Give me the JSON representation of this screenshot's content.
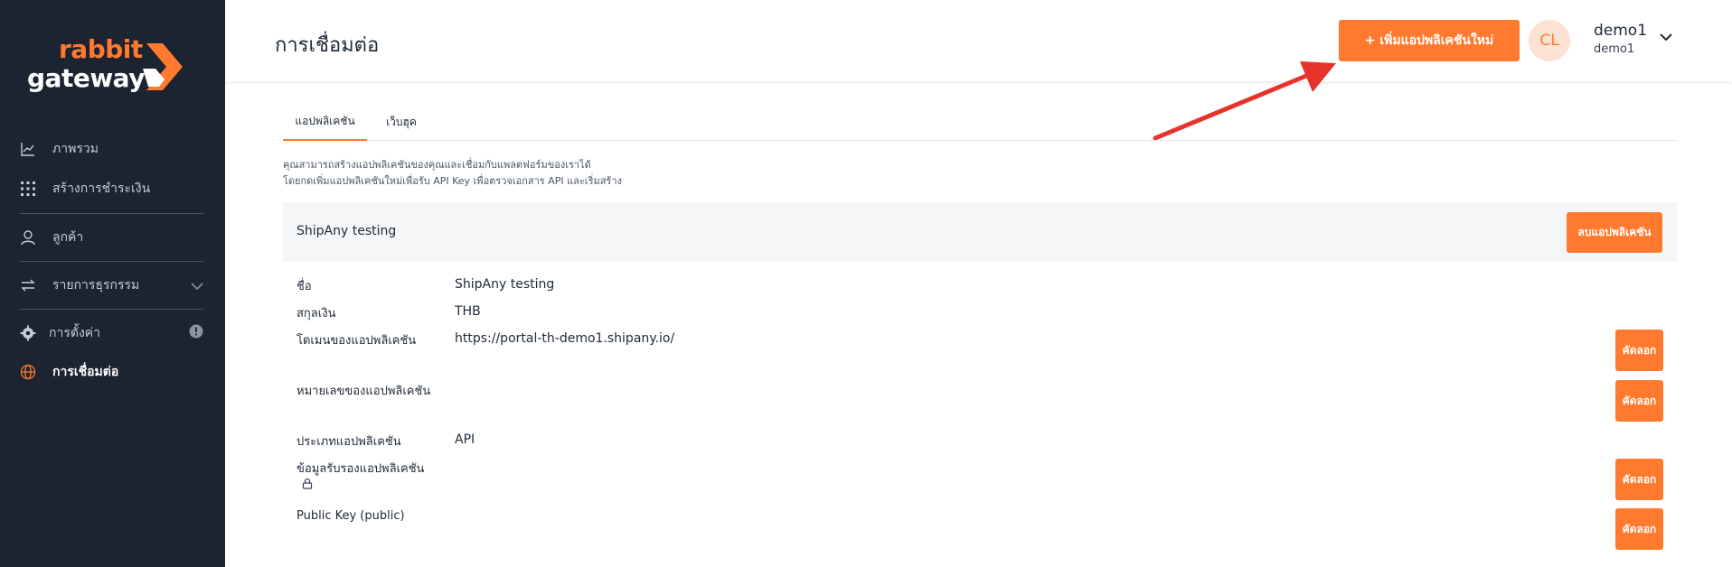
{
  "sidebar": {
    "logo_top": "rabbit",
    "logo_bottom": "gateway",
    "items": [
      {
        "label": "ภาพรวม",
        "icon": "chart-line-icon"
      },
      {
        "label": "สร้างการชำระเงิน",
        "icon": "grid-icon"
      },
      {
        "label": "ลูกค้า",
        "icon": "user-icon"
      },
      {
        "label": "รายการธุรกรรม",
        "icon": "transfer-icon"
      },
      {
        "label": "การตั้งค่า",
        "icon": "gear-icon"
      },
      {
        "label": "การเชื่อมต่อ",
        "icon": "globe-icon"
      }
    ]
  },
  "header": {
    "title": "การเชื่อมต่อ",
    "add_button": "+ เพิ่มแอปพลิเคชันใหม่",
    "avatar_initials": "CL",
    "user_name": "demo1",
    "user_sub": "demo1"
  },
  "tabs": [
    "แอปพลิเคชัน",
    "เว็บฮุค"
  ],
  "description": {
    "line1": "คุณสามารถสร้างแอปพลิเคชันของคุณและเชื่อมกับแพลตฟอร์มของเราได้",
    "line2": "โดยกดเพิ่มแอปพลิเคชันใหม่เพื่อรับ API Key เพื่อตรวจเอกสาร API และเริ่มสร้าง"
  },
  "app": {
    "name": "ShipAny testing",
    "delete_button": "ลบแอปพลิเคชัน",
    "copy_button": "คัดลอก",
    "fields": {
      "name_label": "ชื่อ",
      "name_value": "ShipAny testing",
      "currency_label": "สกุลเงิน",
      "currency_value": "THB",
      "domain_label": "โดเมนของแอปพลิเคชัน",
      "domain_value": "https://portal-th-demo1.shipany.io/",
      "number_label": "หมายเลขของแอปพลิเคชัน",
      "type_label": "ประเภทแอปพลิเคชัน",
      "type_value": "API",
      "cred_label": "ข้อมูลรับรองแอปพลิเคชัน",
      "pubkey_label": "Public Key (public)"
    }
  },
  "colors": {
    "accent": "#ff7a2e",
    "sidebar_bg": "#1c2331",
    "annotation_arrow": "#e8322c"
  }
}
